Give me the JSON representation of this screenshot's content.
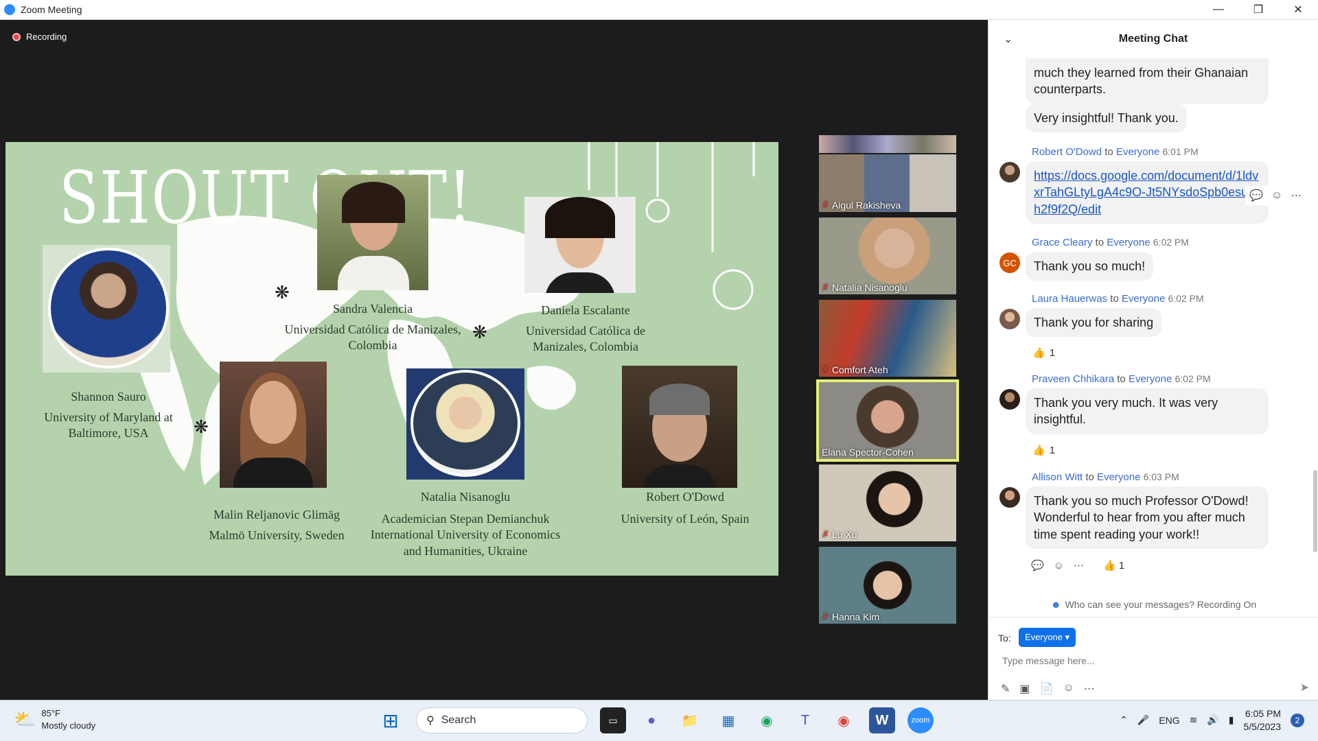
{
  "window": {
    "title": "Zoom Meeting"
  },
  "recording": {
    "label": "Recording"
  },
  "slide": {
    "title": "SHOUT OUT!",
    "people": [
      {
        "name": "Shannon Sauro",
        "affiliation": "University of Maryland at Baltimore, USA"
      },
      {
        "name": "Sandra Valencia",
        "affiliation": "Universidad Católica de Manizales, Colombia"
      },
      {
        "name": "Daniela Escalante",
        "affiliation": "Universidad Católica de Manizales, Colombia"
      },
      {
        "name": "Malin Reljanovic Glimäg",
        "affiliation": "Malmö University, Sweden"
      },
      {
        "name": "Natalia Nisanoglu",
        "affiliation": "Academician Stepan Demianchuk International University of Economics and Humanities, Ukraine"
      },
      {
        "name": "Robert O'Dowd",
        "affiliation": "University of León, Spain"
      }
    ]
  },
  "gallery": [
    {
      "name": "Aigul Rakisheva",
      "muted": true
    },
    {
      "name": "Natalia Nisanoglu",
      "muted": true
    },
    {
      "name": "Comfort Ateh",
      "muted": true
    },
    {
      "name": "Elana Spector-Cohen",
      "muted": false,
      "active": true
    },
    {
      "name": "Lu Xu",
      "muted": true
    },
    {
      "name": "Hanna Kim",
      "muted": true
    }
  ],
  "chat": {
    "title": "Meeting Chat",
    "messages": [
      {
        "text": "much they learned from their Ghanaian counterparts."
      },
      {
        "text": "Very insightful! Thank you."
      },
      {
        "sender": "Robert O'Dowd",
        "to": "Everyone",
        "time": "6:01 PM",
        "link": "https://docs.google.com/document/d/1ldvxrTahGLtyLgA4c9O-Jt5NYsdoSpb0esuBh2f9f2Q/edit"
      },
      {
        "sender": "Grace Cleary",
        "to": "Everyone",
        "time": "6:02 PM",
        "text": "Thank you so much!",
        "initials": "GC"
      },
      {
        "sender": "Laura Hauerwas",
        "to": "Everyone",
        "time": "6:02 PM",
        "text": "Thank you for sharing",
        "reactions": "1"
      },
      {
        "sender": "Praveen Chhikara",
        "to": "Everyone",
        "time": "6:02 PM",
        "text": "Thank you very much. It was very insightful.",
        "reactions": "1"
      },
      {
        "sender": "Allison Witt",
        "to": "Everyone",
        "time": "6:03 PM",
        "text": "Thank you so much Professor O'Dowd! Wonderful to hear from you after much time spent reading your work!!",
        "reactions": "1"
      }
    ],
    "to_word": "to",
    "privacy": "Who can see your messages? Recording On",
    "composer": {
      "to_label": "To:",
      "recipient": "Everyone",
      "placeholder": "Type message here..."
    }
  },
  "taskbar": {
    "weather": {
      "temp": "85°F",
      "desc": "Mostly cloudy"
    },
    "search": "Search",
    "lang": "ENG",
    "time": "6:05 PM",
    "date": "5/5/2023",
    "notifications": "2"
  }
}
